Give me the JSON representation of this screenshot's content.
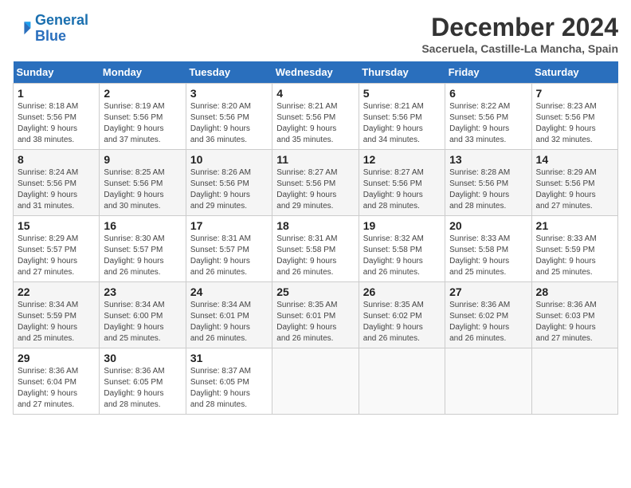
{
  "header": {
    "logo_line1": "General",
    "logo_line2": "Blue",
    "title": "December 2024",
    "subtitle": "Saceruela, Castille-La Mancha, Spain"
  },
  "days_of_week": [
    "Sunday",
    "Monday",
    "Tuesday",
    "Wednesday",
    "Thursday",
    "Friday",
    "Saturday"
  ],
  "weeks": [
    [
      {
        "day": 1,
        "info": "Sunrise: 8:18 AM\nSunset: 5:56 PM\nDaylight: 9 hours\nand 38 minutes."
      },
      {
        "day": 2,
        "info": "Sunrise: 8:19 AM\nSunset: 5:56 PM\nDaylight: 9 hours\nand 37 minutes."
      },
      {
        "day": 3,
        "info": "Sunrise: 8:20 AM\nSunset: 5:56 PM\nDaylight: 9 hours\nand 36 minutes."
      },
      {
        "day": 4,
        "info": "Sunrise: 8:21 AM\nSunset: 5:56 PM\nDaylight: 9 hours\nand 35 minutes."
      },
      {
        "day": 5,
        "info": "Sunrise: 8:21 AM\nSunset: 5:56 PM\nDaylight: 9 hours\nand 34 minutes."
      },
      {
        "day": 6,
        "info": "Sunrise: 8:22 AM\nSunset: 5:56 PM\nDaylight: 9 hours\nand 33 minutes."
      },
      {
        "day": 7,
        "info": "Sunrise: 8:23 AM\nSunset: 5:56 PM\nDaylight: 9 hours\nand 32 minutes."
      }
    ],
    [
      {
        "day": 8,
        "info": "Sunrise: 8:24 AM\nSunset: 5:56 PM\nDaylight: 9 hours\nand 31 minutes."
      },
      {
        "day": 9,
        "info": "Sunrise: 8:25 AM\nSunset: 5:56 PM\nDaylight: 9 hours\nand 30 minutes."
      },
      {
        "day": 10,
        "info": "Sunrise: 8:26 AM\nSunset: 5:56 PM\nDaylight: 9 hours\nand 29 minutes."
      },
      {
        "day": 11,
        "info": "Sunrise: 8:27 AM\nSunset: 5:56 PM\nDaylight: 9 hours\nand 29 minutes."
      },
      {
        "day": 12,
        "info": "Sunrise: 8:27 AM\nSunset: 5:56 PM\nDaylight: 9 hours\nand 28 minutes."
      },
      {
        "day": 13,
        "info": "Sunrise: 8:28 AM\nSunset: 5:56 PM\nDaylight: 9 hours\nand 28 minutes."
      },
      {
        "day": 14,
        "info": "Sunrise: 8:29 AM\nSunset: 5:56 PM\nDaylight: 9 hours\nand 27 minutes."
      }
    ],
    [
      {
        "day": 15,
        "info": "Sunrise: 8:29 AM\nSunset: 5:57 PM\nDaylight: 9 hours\nand 27 minutes."
      },
      {
        "day": 16,
        "info": "Sunrise: 8:30 AM\nSunset: 5:57 PM\nDaylight: 9 hours\nand 26 minutes."
      },
      {
        "day": 17,
        "info": "Sunrise: 8:31 AM\nSunset: 5:57 PM\nDaylight: 9 hours\nand 26 minutes."
      },
      {
        "day": 18,
        "info": "Sunrise: 8:31 AM\nSunset: 5:58 PM\nDaylight: 9 hours\nand 26 minutes."
      },
      {
        "day": 19,
        "info": "Sunrise: 8:32 AM\nSunset: 5:58 PM\nDaylight: 9 hours\nand 26 minutes."
      },
      {
        "day": 20,
        "info": "Sunrise: 8:33 AM\nSunset: 5:58 PM\nDaylight: 9 hours\nand 25 minutes."
      },
      {
        "day": 21,
        "info": "Sunrise: 8:33 AM\nSunset: 5:59 PM\nDaylight: 9 hours\nand 25 minutes."
      }
    ],
    [
      {
        "day": 22,
        "info": "Sunrise: 8:34 AM\nSunset: 5:59 PM\nDaylight: 9 hours\nand 25 minutes."
      },
      {
        "day": 23,
        "info": "Sunrise: 8:34 AM\nSunset: 6:00 PM\nDaylight: 9 hours\nand 25 minutes."
      },
      {
        "day": 24,
        "info": "Sunrise: 8:34 AM\nSunset: 6:01 PM\nDaylight: 9 hours\nand 26 minutes."
      },
      {
        "day": 25,
        "info": "Sunrise: 8:35 AM\nSunset: 6:01 PM\nDaylight: 9 hours\nand 26 minutes."
      },
      {
        "day": 26,
        "info": "Sunrise: 8:35 AM\nSunset: 6:02 PM\nDaylight: 9 hours\nand 26 minutes."
      },
      {
        "day": 27,
        "info": "Sunrise: 8:36 AM\nSunset: 6:02 PM\nDaylight: 9 hours\nand 26 minutes."
      },
      {
        "day": 28,
        "info": "Sunrise: 8:36 AM\nSunset: 6:03 PM\nDaylight: 9 hours\nand 27 minutes."
      }
    ],
    [
      {
        "day": 29,
        "info": "Sunrise: 8:36 AM\nSunset: 6:04 PM\nDaylight: 9 hours\nand 27 minutes."
      },
      {
        "day": 30,
        "info": "Sunrise: 8:36 AM\nSunset: 6:05 PM\nDaylight: 9 hours\nand 28 minutes."
      },
      {
        "day": 31,
        "info": "Sunrise: 8:37 AM\nSunset: 6:05 PM\nDaylight: 9 hours\nand 28 minutes."
      },
      null,
      null,
      null,
      null
    ]
  ]
}
